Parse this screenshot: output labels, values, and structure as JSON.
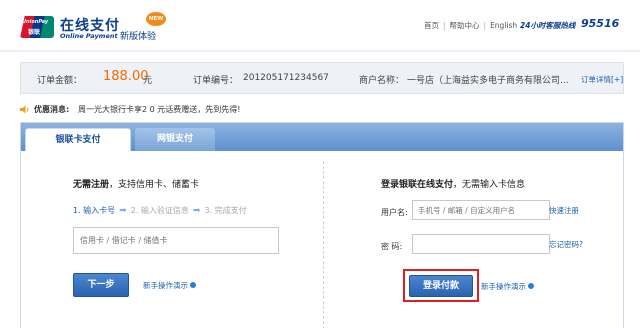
{
  "header": {
    "logo": {
      "en": "UnionPay",
      "cn": "银联"
    },
    "brand_cn": "在线支付",
    "brand_en": "Online Payment",
    "new_badge": "NEW",
    "new_version": "新版体验",
    "links": [
      "首页",
      "帮助中心",
      "English"
    ],
    "hotline_label": "24小时客服热线",
    "hotline_number": "95516"
  },
  "order": {
    "amount_label": "订单金额：",
    "amount": "188.00",
    "amount_unit": "元",
    "number_label": "订单编号：",
    "number": "201205171234567",
    "merchant_label": "商户名称：",
    "merchant": "一号店（上海益实多电子商务有限公司...",
    "detail_link": "订单详情[+]"
  },
  "notice": {
    "label": "优惠消息:",
    "text": "周一光大银行卡享2 0 元话费赠送，先到先得!"
  },
  "tabs": [
    {
      "label": "银联卡支付",
      "active": true
    },
    {
      "label": "网银支付",
      "active": false
    }
  ],
  "left": {
    "title_bold": "无需注册",
    "title_rest": "，支持信用卡、储蓄卡",
    "steps": [
      "1. 输入卡号",
      "2. 输入验证信息",
      "3. 完成支付"
    ],
    "card_placeholder": "信用卡 / 借记卡 / 储值卡",
    "next_button": "下一步",
    "demo_link": "新手操作演示"
  },
  "right": {
    "title_bold": "登录银联在线支付",
    "title_rest": "，无需输入卡信息",
    "username_label": "用户名:",
    "username_placeholder": "手机号 / 邮箱 / 自定义用户名",
    "register_link": "快速注册",
    "password_label": "密   码:",
    "forgot_link": "忘记密码?",
    "login_button": "登录付款",
    "demo_link": "新手操作演示"
  },
  "colors": {
    "brand_blue": "#0b3f8f",
    "amount_orange": "#f06a00",
    "highlight_red": "#e02020",
    "button_blue": "#2a63b1"
  }
}
